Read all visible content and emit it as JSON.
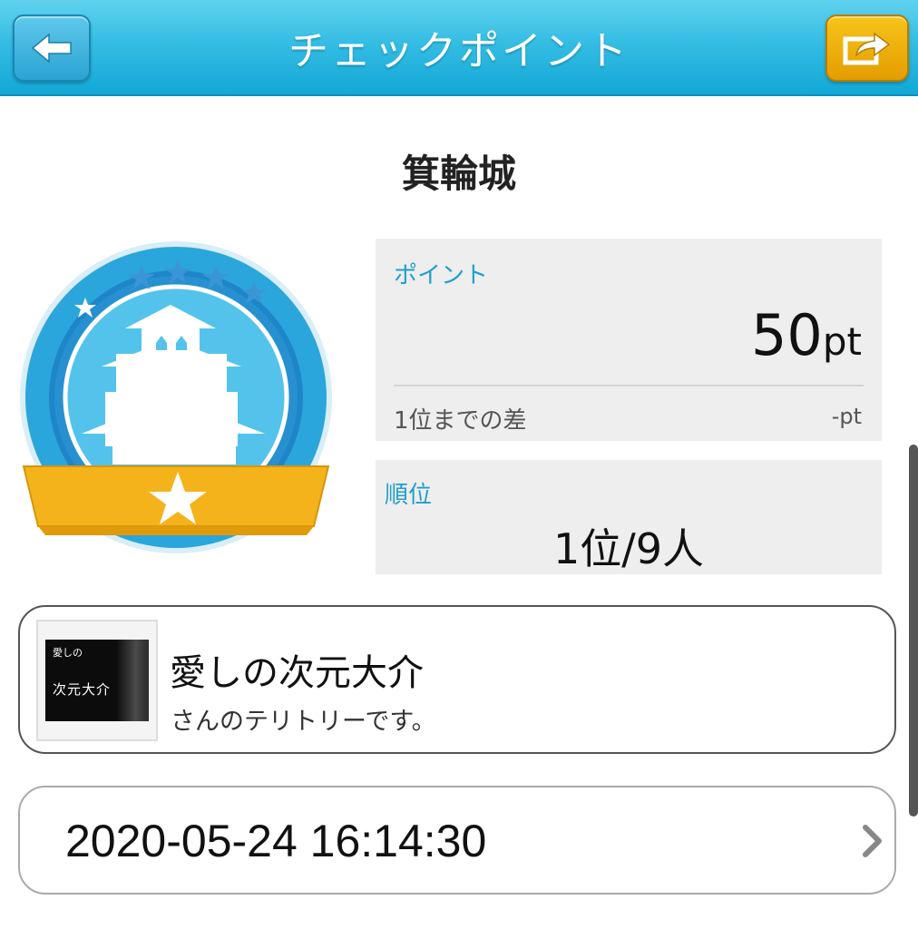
{
  "header": {
    "title": "チェックポイント",
    "back_icon": "arrow-left-icon",
    "share_icon": "share-icon",
    "colors": {
      "bar": "#35bde3",
      "share_button": "#f2b20c"
    }
  },
  "place": {
    "name": "箕輪城"
  },
  "badge": {
    "icon": "castle-badge-icon",
    "colors": {
      "ring": "#2aa6dc",
      "ribbon": "#f5b31b"
    }
  },
  "points": {
    "label": "ポイント",
    "value": "50",
    "unit": "pt",
    "diff_label": "1位までの差",
    "diff_value": "-pt"
  },
  "rank": {
    "label": "順位",
    "value": "1位/9人"
  },
  "owner": {
    "name": "愛しの次元大介",
    "subtitle": "さんのテリトリーです。",
    "thumb_text_small": "愛しの",
    "thumb_text_big": "次元大介"
  },
  "checkin": {
    "datetime": "2020-05-24 16:14:30",
    "chevron_icon": "chevron-right-icon"
  }
}
